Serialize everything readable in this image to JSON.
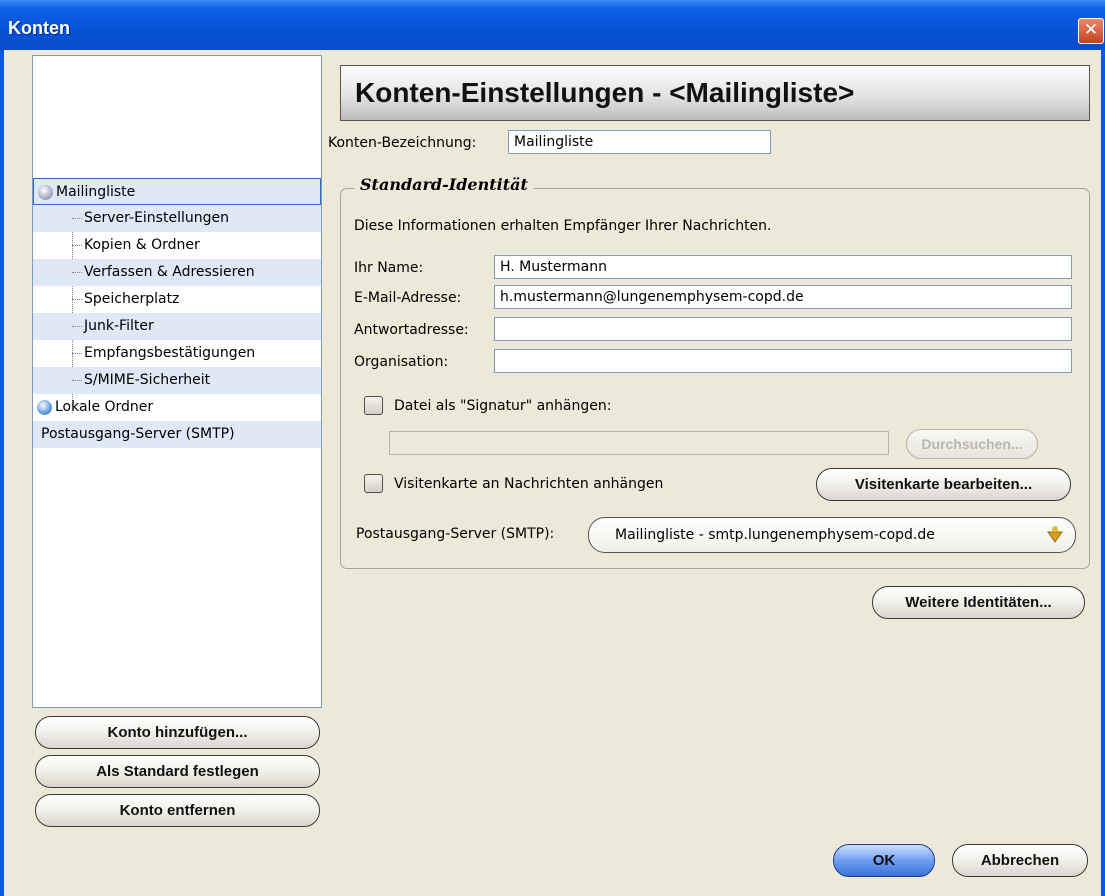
{
  "window": {
    "title": "Konten",
    "close_glyph": "✕"
  },
  "sidebar": {
    "tree": [
      {
        "label": "Mailingliste",
        "level": 0,
        "icon": "account-icon",
        "selected": true
      },
      {
        "label": "Server-Einstellungen",
        "level": 1
      },
      {
        "label": "Kopien & Ordner",
        "level": 1
      },
      {
        "label": "Verfassen & Adressieren",
        "level": 1
      },
      {
        "label": "Speicherplatz",
        "level": 1
      },
      {
        "label": "Junk-Filter",
        "level": 1
      },
      {
        "label": "Empfangsbestätigungen",
        "level": 1
      },
      {
        "label": "S/MIME-Sicherheit",
        "level": 1
      },
      {
        "label": "Lokale Ordner",
        "level": 0,
        "icon": "local-folders-icon"
      },
      {
        "label": "Postausgang-Server (SMTP)",
        "level": 0
      }
    ],
    "buttons": {
      "add_account": "Konto hinzufügen...",
      "set_default": "Als Standard festlegen",
      "remove_account": "Konto entfernen"
    }
  },
  "main": {
    "header": "Konten-Einstellungen - <Mailingliste>",
    "account_name_label": "Konten-Bezeichnung:",
    "account_name_value": "Mailingliste",
    "identity": {
      "legend": "Standard-Identität",
      "info": "Diese Informationen erhalten Empfänger Ihrer Nachrichten.",
      "name_label": "Ihr Name:",
      "name_value": "H. Mustermann",
      "email_label": "E-Mail-Adresse:",
      "email_value": "h.mustermann@lungenemphysem-copd.de",
      "reply_label": "Antwortadresse:",
      "reply_value": "",
      "org_label": "Organisation:",
      "org_value": "",
      "signature_checkbox_label": "Datei als \"Signatur\" anhängen:",
      "signature_checked": false,
      "signature_path": "",
      "browse_button": "Durchsuchen...",
      "vcard_checkbox_label": "Visitenkarte an Nachrichten anhängen",
      "vcard_checked": false,
      "vcard_edit_button": "Visitenkarte bearbeiten...",
      "smtp_label": "Postausgang-Server (SMTP):",
      "smtp_value": "Mailingliste - smtp.lungenemphysem-copd.de"
    },
    "more_identities_button": "Weitere Identitäten..."
  },
  "footer": {
    "ok_button": "OK",
    "cancel_button": "Abbrechen"
  }
}
